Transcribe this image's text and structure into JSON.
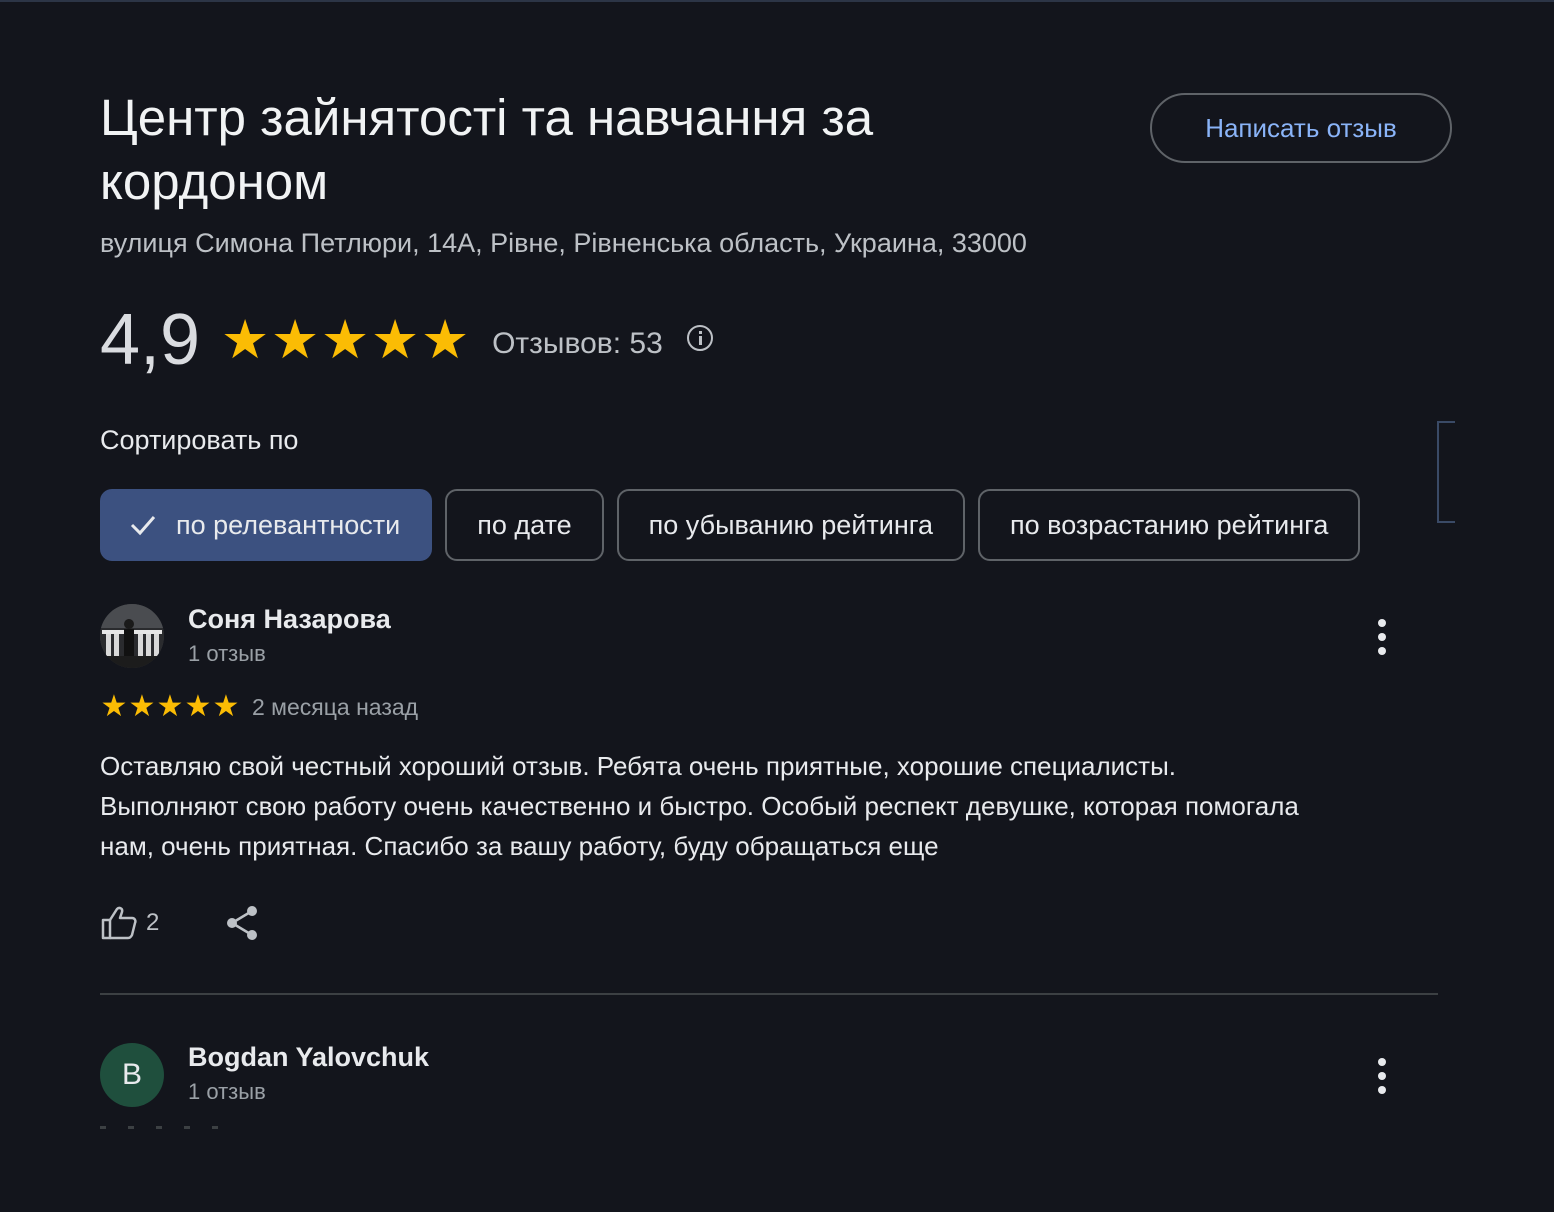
{
  "place": {
    "title": "Центр зайнятості та навчання за кордоном",
    "address": "вулиця Симона Петлюри, 14А, Рівне, Рівненська область, Украина, 33000",
    "write_review_label": "Написать отзыв"
  },
  "rating": {
    "value_text": "4,9",
    "stars": 5,
    "review_count_text": "Отзывов: 53"
  },
  "sort": {
    "label": "Сортировать по",
    "options": [
      {
        "label": "по релевантности",
        "selected": true
      },
      {
        "label": "по дате",
        "selected": false
      },
      {
        "label": "по убыванию рейтинга",
        "selected": false
      },
      {
        "label": "по возрастанию рейтинга",
        "selected": false
      }
    ]
  },
  "reviews": [
    {
      "author": "Соня Назарова",
      "meta": "1 отзыв",
      "stars": 5,
      "date": "2 месяца назад",
      "text": "Оставляю свой честный хороший отзыв. Ребята очень приятные, хорошие специалисты. Выполняют свою работу очень качественно и быстро. Особый респект девушке, которая помогала нам, очень приятная. Спасибо за вашу работу, буду обращаться еще",
      "likes": "2"
    },
    {
      "author": "Bogdan Yalovchuk",
      "meta": "1 отзыв",
      "avatar_letter": "B"
    }
  ],
  "colors": {
    "background": "#13151c",
    "accent_link": "#8ab4f8",
    "star": "#fbbc04",
    "chip_selected": "#3c5180",
    "avatar_b": "#1f4f3d"
  }
}
